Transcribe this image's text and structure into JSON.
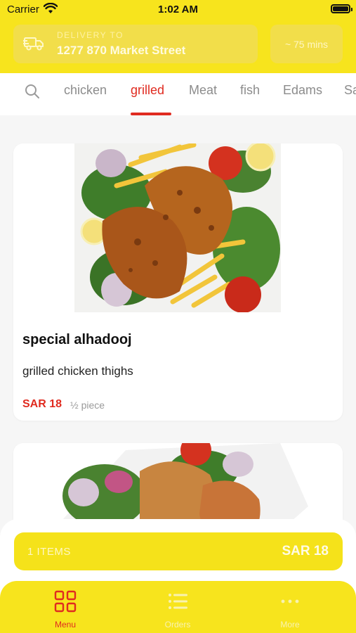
{
  "status": {
    "carrier": "Carrier",
    "time": "1:02 AM"
  },
  "delivery": {
    "label": "DELIVERY TO",
    "address": "1277 870 Market Street",
    "eta": "~ 75 mins"
  },
  "categories": {
    "tabs": [
      "chicken",
      "grilled",
      "Meat",
      "fish",
      "Edams",
      "Sa"
    ],
    "active": "grilled"
  },
  "menu_items": [
    {
      "title": "special alhadooj",
      "description": "grilled chicken thighs",
      "price": "SAR 18",
      "portion": "½ piece"
    }
  ],
  "cart": {
    "items": "1 ITEMS",
    "total": "SAR 18"
  },
  "nav": {
    "menu": "Menu",
    "orders": "Orders",
    "more": "More"
  },
  "colors": {
    "brand_yellow": "#f7e41d",
    "accent_red": "#e02b20"
  }
}
